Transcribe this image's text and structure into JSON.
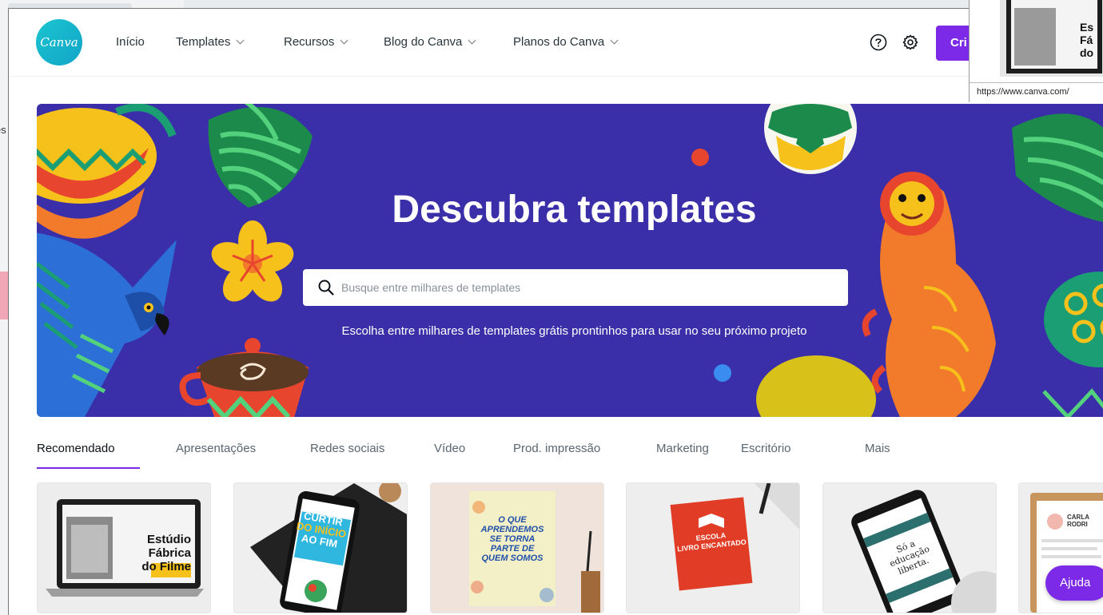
{
  "nav": {
    "logo_text": "Canva",
    "items": [
      {
        "label": "Início"
      },
      {
        "label": "Templates"
      },
      {
        "label": "Recursos"
      },
      {
        "label": "Blog do Canva"
      },
      {
        "label": "Planos do Canva"
      }
    ],
    "cta_label": "Cri"
  },
  "hero": {
    "title": "Descubra templates",
    "search_placeholder": "Busque entre milhares de templates",
    "subtitle": "Escolha entre milhares de templates grátis prontinhos para usar no seu próximo projeto"
  },
  "tabs": [
    {
      "label": "Recomendado"
    },
    {
      "label": "Apresentações"
    },
    {
      "label": "Redes sociais"
    },
    {
      "label": "Vídeo"
    },
    {
      "label": "Prod. impressão"
    },
    {
      "label": "Marketing"
    },
    {
      "label": "Escritório"
    },
    {
      "label": "Mais"
    }
  ],
  "cards": [
    {
      "lines": [
        "Estúdio",
        "Fábrica",
        "do Filme"
      ]
    },
    {
      "lines": [
        "CURTIR",
        "DO INÍCIO",
        "AO FIM"
      ]
    },
    {
      "lines": [
        "O QUE",
        "APRENDEMOS",
        "SE TORNA",
        "PARTE DE",
        "QUEM SOMOS"
      ]
    },
    {
      "lines": [
        "ESCOLA",
        "LIVRO ENCANTADO"
      ]
    },
    {
      "lines": [
        "Só a",
        "educação",
        "liberta."
      ]
    },
    {
      "lines": [
        "CARLA",
        "RODRI"
      ]
    }
  ],
  "popup": {
    "thumb_lines": [
      "Es",
      "Fá",
      "do"
    ],
    "url": "https://www.canva.com/"
  },
  "help_label": "Ajuda",
  "background_text": "es",
  "colors": {
    "brand_purple": "#7d2ae8",
    "hero_blue": "#3a2fa9",
    "logo_teal": "#1ac5cf"
  }
}
